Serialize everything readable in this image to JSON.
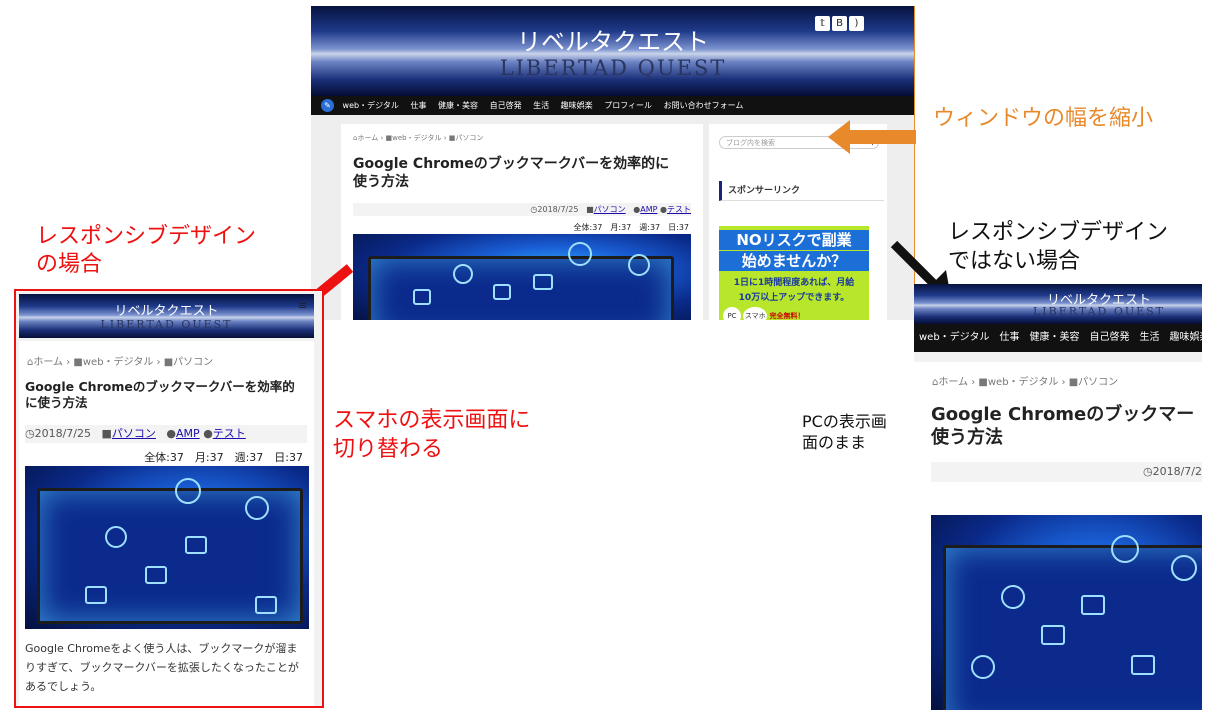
{
  "blog": {
    "title": "リベルタクエスト",
    "subtitle": "LIBERTAD QUEST"
  },
  "nav": {
    "items": [
      "web・デジタル",
      "仕事",
      "健康・美容",
      "自己啓発",
      "生活",
      "趣味娯楽",
      "プロフィール",
      "お問い合わせフォーム"
    ]
  },
  "breadcrumb": {
    "home": "ホーム",
    "cat1": "web・デジタル",
    "cat2": "パソコン"
  },
  "article": {
    "title": "Google Chromeのブックマークバーを効率的に使う方法",
    "title_line1_mobile": "Google Chromeのブックマークバーを効率的",
    "title_line2_mobile": "に使う方法",
    "title_line1_pc": "Google Chromeのブックマークバーを効率的に",
    "title_line2_pc": "使う方法",
    "title_line1_narrow": "Google Chromeのブックマー",
    "title_line2_narrow": "使う方法",
    "date": "2018/7/25",
    "date_cut": "2018/7/2",
    "tags": [
      "パソコン",
      "AMP",
      "テスト"
    ],
    "stats": "全体:37　月:37　週:37　日:37",
    "excerpt": "Google Chromeをよく使う人は、ブックマークが溜まりすぎて、ブックマークバーを拡張したくなったことがあるでしょう。"
  },
  "sidebar": {
    "search_placeholder": "ブログ内を検索",
    "sponsor_heading": "スポンサーリンク",
    "ad_line1": "NOリスクで副業",
    "ad_line2": "始めませんか？",
    "ad_line3": "1日に1時間程度あれば、月給",
    "ad_line4": "10万以上アップできます。",
    "ad_badge1": "PC",
    "ad_badge2": "スマホ",
    "ad_badge3": "完全無料！"
  },
  "annotations": {
    "shrink": "ウィンドウの幅を縮小",
    "responsive_1": "レスポンシブデザイン",
    "responsive_2": "の場合",
    "switch_1": "スマホの表示画面に",
    "switch_2": "切り替わる",
    "nonresponsive_1": "レスポンシブデザイン",
    "nonresponsive_2": "ではない場合",
    "pc_1": "PCの表示画",
    "pc_2": "面のまま"
  },
  "colors": {
    "orange": "#e8892b",
    "red": "#ee1111",
    "nav_bg": "#111111"
  }
}
